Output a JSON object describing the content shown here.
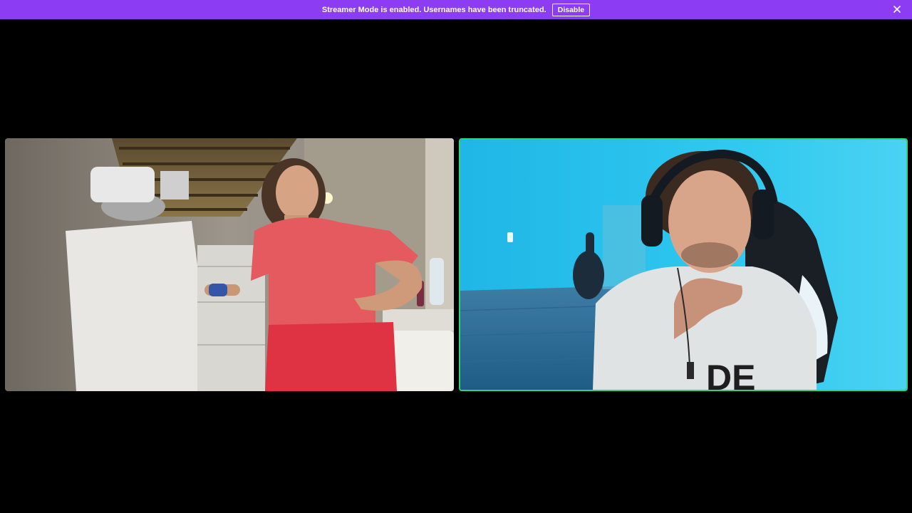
{
  "banner": {
    "message": "Streamer Mode is enabled. Usernames have been truncated.",
    "disable_label": "Disable",
    "background": "#8c3cf2",
    "close_icon": "close-icon"
  },
  "call": {
    "active_speaker_border": "#33d17a",
    "participants": [
      {
        "tile": "left",
        "speaking": false,
        "scene": "kitchen"
      },
      {
        "tile": "right",
        "speaking": true,
        "scene": "blue-lit gaming room"
      }
    ],
    "right_shirt_text": "DE"
  }
}
